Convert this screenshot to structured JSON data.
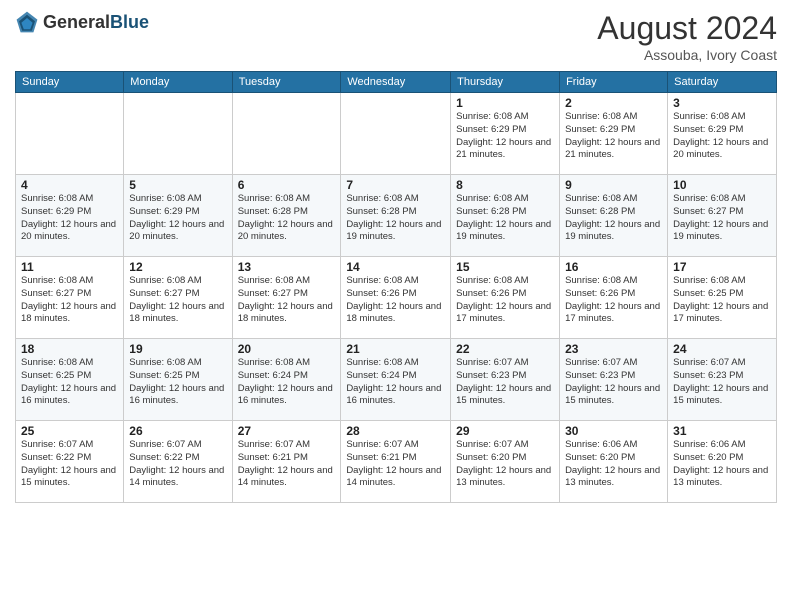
{
  "logo": {
    "general": "General",
    "blue": "Blue"
  },
  "title": "August 2024",
  "subtitle": "Assouba, Ivory Coast",
  "days_of_week": [
    "Sunday",
    "Monday",
    "Tuesday",
    "Wednesday",
    "Thursday",
    "Friday",
    "Saturday"
  ],
  "weeks": [
    [
      {
        "day": "",
        "info": ""
      },
      {
        "day": "",
        "info": ""
      },
      {
        "day": "",
        "info": ""
      },
      {
        "day": "",
        "info": ""
      },
      {
        "day": "1",
        "info": "Sunrise: 6:08 AM\nSunset: 6:29 PM\nDaylight: 12 hours and 21 minutes."
      },
      {
        "day": "2",
        "info": "Sunrise: 6:08 AM\nSunset: 6:29 PM\nDaylight: 12 hours and 21 minutes."
      },
      {
        "day": "3",
        "info": "Sunrise: 6:08 AM\nSunset: 6:29 PM\nDaylight: 12 hours and 20 minutes."
      }
    ],
    [
      {
        "day": "4",
        "info": "Sunrise: 6:08 AM\nSunset: 6:29 PM\nDaylight: 12 hours and 20 minutes."
      },
      {
        "day": "5",
        "info": "Sunrise: 6:08 AM\nSunset: 6:29 PM\nDaylight: 12 hours and 20 minutes."
      },
      {
        "day": "6",
        "info": "Sunrise: 6:08 AM\nSunset: 6:28 PM\nDaylight: 12 hours and 20 minutes."
      },
      {
        "day": "7",
        "info": "Sunrise: 6:08 AM\nSunset: 6:28 PM\nDaylight: 12 hours and 19 minutes."
      },
      {
        "day": "8",
        "info": "Sunrise: 6:08 AM\nSunset: 6:28 PM\nDaylight: 12 hours and 19 minutes."
      },
      {
        "day": "9",
        "info": "Sunrise: 6:08 AM\nSunset: 6:28 PM\nDaylight: 12 hours and 19 minutes."
      },
      {
        "day": "10",
        "info": "Sunrise: 6:08 AM\nSunset: 6:27 PM\nDaylight: 12 hours and 19 minutes."
      }
    ],
    [
      {
        "day": "11",
        "info": "Sunrise: 6:08 AM\nSunset: 6:27 PM\nDaylight: 12 hours and 18 minutes."
      },
      {
        "day": "12",
        "info": "Sunrise: 6:08 AM\nSunset: 6:27 PM\nDaylight: 12 hours and 18 minutes."
      },
      {
        "day": "13",
        "info": "Sunrise: 6:08 AM\nSunset: 6:27 PM\nDaylight: 12 hours and 18 minutes."
      },
      {
        "day": "14",
        "info": "Sunrise: 6:08 AM\nSunset: 6:26 PM\nDaylight: 12 hours and 18 minutes."
      },
      {
        "day": "15",
        "info": "Sunrise: 6:08 AM\nSunset: 6:26 PM\nDaylight: 12 hours and 17 minutes."
      },
      {
        "day": "16",
        "info": "Sunrise: 6:08 AM\nSunset: 6:26 PM\nDaylight: 12 hours and 17 minutes."
      },
      {
        "day": "17",
        "info": "Sunrise: 6:08 AM\nSunset: 6:25 PM\nDaylight: 12 hours and 17 minutes."
      }
    ],
    [
      {
        "day": "18",
        "info": "Sunrise: 6:08 AM\nSunset: 6:25 PM\nDaylight: 12 hours and 16 minutes."
      },
      {
        "day": "19",
        "info": "Sunrise: 6:08 AM\nSunset: 6:25 PM\nDaylight: 12 hours and 16 minutes."
      },
      {
        "day": "20",
        "info": "Sunrise: 6:08 AM\nSunset: 6:24 PM\nDaylight: 12 hours and 16 minutes."
      },
      {
        "day": "21",
        "info": "Sunrise: 6:08 AM\nSunset: 6:24 PM\nDaylight: 12 hours and 16 minutes."
      },
      {
        "day": "22",
        "info": "Sunrise: 6:07 AM\nSunset: 6:23 PM\nDaylight: 12 hours and 15 minutes."
      },
      {
        "day": "23",
        "info": "Sunrise: 6:07 AM\nSunset: 6:23 PM\nDaylight: 12 hours and 15 minutes."
      },
      {
        "day": "24",
        "info": "Sunrise: 6:07 AM\nSunset: 6:23 PM\nDaylight: 12 hours and 15 minutes."
      }
    ],
    [
      {
        "day": "25",
        "info": "Sunrise: 6:07 AM\nSunset: 6:22 PM\nDaylight: 12 hours and 15 minutes."
      },
      {
        "day": "26",
        "info": "Sunrise: 6:07 AM\nSunset: 6:22 PM\nDaylight: 12 hours and 14 minutes."
      },
      {
        "day": "27",
        "info": "Sunrise: 6:07 AM\nSunset: 6:21 PM\nDaylight: 12 hours and 14 minutes."
      },
      {
        "day": "28",
        "info": "Sunrise: 6:07 AM\nSunset: 6:21 PM\nDaylight: 12 hours and 14 minutes."
      },
      {
        "day": "29",
        "info": "Sunrise: 6:07 AM\nSunset: 6:20 PM\nDaylight: 12 hours and 13 minutes."
      },
      {
        "day": "30",
        "info": "Sunrise: 6:06 AM\nSunset: 6:20 PM\nDaylight: 12 hours and 13 minutes."
      },
      {
        "day": "31",
        "info": "Sunrise: 6:06 AM\nSunset: 6:20 PM\nDaylight: 12 hours and 13 minutes."
      }
    ]
  ]
}
